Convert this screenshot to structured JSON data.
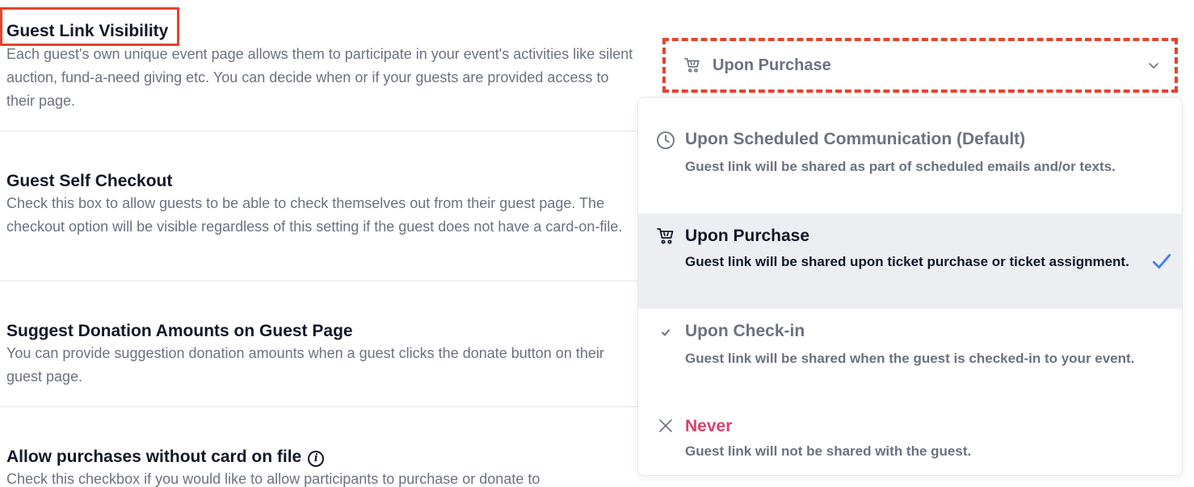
{
  "settings": [
    {
      "title": "Guest Link Visibility",
      "description": "Each guest's own unique event page allows them to participate in your event's activities like silent auction, fund-a-need giving etc. You can decide when or if your guests are provided access to their page."
    },
    {
      "title": "Guest Self Checkout",
      "description": "Check this box to allow guests to be able to check themselves out from their guest page. The checkout option will be visible regardless of this setting if the guest does not have a card-on-file."
    },
    {
      "title": "Suggest Donation Amounts on Guest Page",
      "description": "You can provide suggestion donation amounts when a guest clicks the donate button on their guest page."
    },
    {
      "title": "Allow purchases without card on file",
      "description": "Check this checkbox if you would like to allow participants to purchase or donate to"
    }
  ],
  "select": {
    "value": "Upon Purchase",
    "icon": "cart-icon"
  },
  "options": [
    {
      "label": "Upon Scheduled Communication (Default)",
      "sub": "Guest link will be shared as part of scheduled emails and/or texts.",
      "icon": "clock-icon"
    },
    {
      "label": "Upon Purchase",
      "sub": "Guest link will be shared upon ticket purchase or ticket assignment.",
      "icon": "cart-icon",
      "selected": true
    },
    {
      "label": "Upon Check-in",
      "sub": "Guest link will be shared when the guest is checked-in to your event.",
      "icon": "check-icon"
    },
    {
      "label": "Never",
      "sub": "Guest link will not be shared with the guest.",
      "icon": "x-icon"
    }
  ],
  "colors": {
    "highlight": "#e5432d",
    "selected_bg": "#eceef2",
    "check_blue": "#3b82f6",
    "never_red": "#d9446c"
  }
}
